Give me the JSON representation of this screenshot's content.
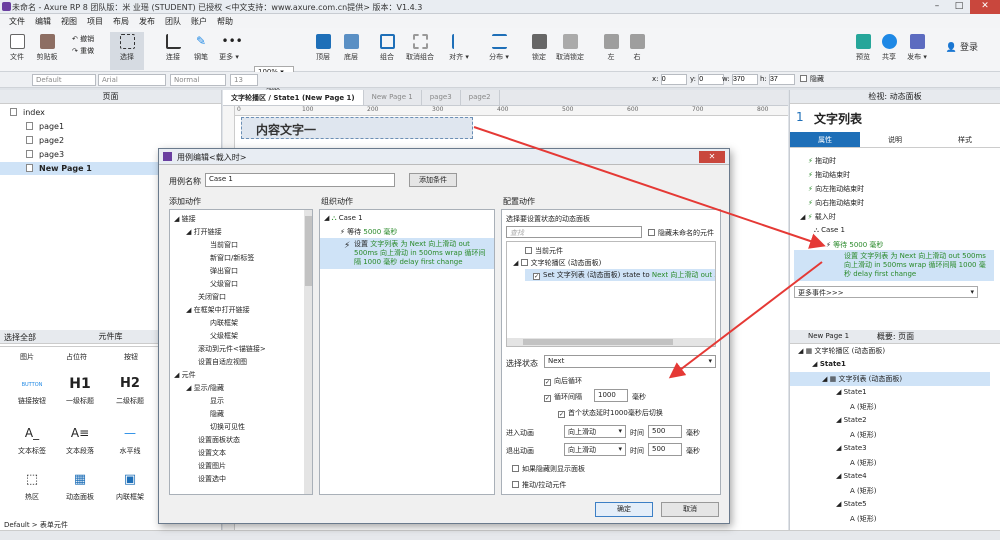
{
  "window": {
    "title": "未命名 - Axure RP 8 团队版：米 业瑶 (STUDENT) 已授权     <中文支持：www.axure.com.cn提供> 版本：V1.4.3"
  },
  "menu": [
    "文件",
    "编辑",
    "视图",
    "项目",
    "布局",
    "发布",
    "团队",
    "账户",
    "帮助"
  ],
  "toolbar": {
    "file": "文件",
    "clipboard": "剪贴板",
    "undo": "撤销",
    "redo": "重做",
    "select": "选择",
    "connect": "连接",
    "pen": "钢笔",
    "more": "更多 ▾",
    "zoom_value": "100%",
    "zoom_label": "缩放",
    "top": "顶层",
    "bottom": "底层",
    "group": "组合",
    "ungroup": "取消组合",
    "align": "对齐 ▾",
    "distribute": "分布 ▾",
    "lock": "锁定",
    "unlock": "取消锁定",
    "left": "左",
    "right": "右",
    "preview": "预览",
    "share": "共享",
    "publish": "发布 ▾",
    "login": "登录"
  },
  "format": {
    "style": "Default",
    "font": "Arial",
    "weight": "Normal",
    "size": "13",
    "x_label": "x:",
    "x": "0",
    "y_label": "y:",
    "y": "0",
    "w_label": "w:",
    "w": "370",
    "h_label": "h:",
    "h": "37",
    "hidden": "隐藏"
  },
  "pages_panel": {
    "title": "页面",
    "items": [
      "index",
      "page1",
      "page2",
      "page3",
      "New Page 1"
    ]
  },
  "library_panel": {
    "title": "元件库",
    "select_all": "选择全部",
    "columns": [
      "图片",
      "占位符",
      "按钮"
    ],
    "widgets": [
      {
        "label": "链接按钮",
        "glyph": "BUTTON"
      },
      {
        "label": "一级标题",
        "glyph": "H1"
      },
      {
        "label": "二级标题",
        "glyph": "H2"
      },
      {
        "label": "文本标签",
        "glyph": "A_"
      },
      {
        "label": "文本段落",
        "glyph": "A≡"
      },
      {
        "label": "水平线",
        "glyph": "—"
      },
      {
        "label": "热区",
        "glyph": "⬚"
      },
      {
        "label": "动态面板",
        "glyph": "▦"
      },
      {
        "label": "内联框架",
        "glyph": "▣"
      }
    ]
  },
  "status_left": "Default > 表单元件",
  "tabs": [
    "文字轮播区 / State1 (New Page 1)",
    "New Page 1",
    "page3",
    "page2"
  ],
  "ruler": [
    "0",
    "100",
    "200",
    "300",
    "400",
    "500",
    "600",
    "700",
    "800"
  ],
  "canvas": {
    "widget_text": "内容文字一"
  },
  "inspector": {
    "header": "检视: 动态面板",
    "number": "1",
    "title": "文字列表",
    "tabs": [
      "属性",
      "说明",
      "样式"
    ],
    "events": [
      "拖动时",
      "拖动结束时",
      "向左拖动结束时",
      "向右拖动结束时",
      "载入时"
    ],
    "case": "Case 1",
    "wait": "等待 5000 毫秒",
    "action": "设置 文字列表 为 Next 向上滑动 out 500ms 向上滑动 in 500ms wrap 循环间隔 1000 毫秒 delay first change",
    "more_events": "更多事件>>>"
  },
  "outline": {
    "header": "概要: 页面",
    "page": "New Page 1",
    "items": [
      "文字轮播区 (动态面板)",
      "State1",
      "文字列表 (动态面板)",
      "State1",
      "(矩形)",
      "State2",
      "(矩形)",
      "State3",
      "(矩形)",
      "State4",
      "(矩形)",
      "State5",
      "(矩形)"
    ]
  },
  "dialog": {
    "title": "用例编辑<载入时>",
    "case_name_label": "用例名称",
    "case_name": "Case 1",
    "add_condition": "添加条件",
    "col_add": "添加动作",
    "col_org": "组织动作",
    "col_config": "配置动作",
    "actions": [
      "链接",
      "打开链接",
      "当前窗口",
      "新窗口/新标签",
      "弹出窗口",
      "父级窗口",
      "关闭窗口",
      "在框架中打开链接",
      "内联框架",
      "父级框架",
      "滚动到元件<锚链接>",
      "设置自适应视图",
      "元件",
      "显示/隐藏",
      "显示",
      "隐藏",
      "切换可见性",
      "设置面板状态",
      "设置文本",
      "设置图片",
      "设置选中"
    ],
    "org_case": "Case 1",
    "org_wait_prefix": "等待 ",
    "org_wait": "5000 毫秒",
    "org_set_prefix": "设置 ",
    "org_set": "文字列表 为 Next 向上滑动 out 500ms 向上滑动 in 500ms wrap 循环间隔 1000 毫秒 delay first change",
    "config_label": "选择要设置状态的动态面板",
    "search_placeholder": "查找",
    "hide_unnamed": "隐藏未命名的元件",
    "current_widget": "当前元件",
    "panel_item": "文字轮播区 (动态面板)",
    "set_item_prefix": "Set 文字列表 (动态面板) state to ",
    "set_item": "Next 向上滑动 out 500ms",
    "state_label": "选择状态",
    "state_value": "Next",
    "wrap": "向后循环",
    "interval": "循环间隔",
    "interval_value": "1000",
    "interval_unit": "毫秒",
    "first_delay": "首个状态延时1000毫秒后切换",
    "enter_label": "进入动画",
    "enter_value": "向上滑动",
    "time": "时间",
    "enter_time": "500",
    "ms": "毫秒",
    "exit_label": "退出动画",
    "exit_value": "向上滑动",
    "exit_time": "500",
    "show_if_hidden": "如果隐藏则显示面板",
    "push_pull": "推动/拉动元件",
    "ok": "确定",
    "cancel": "取消"
  },
  "colors": {
    "accent": "#e53935",
    "selection": "#cfe3f7",
    "green_text": "#2a8a2a"
  }
}
